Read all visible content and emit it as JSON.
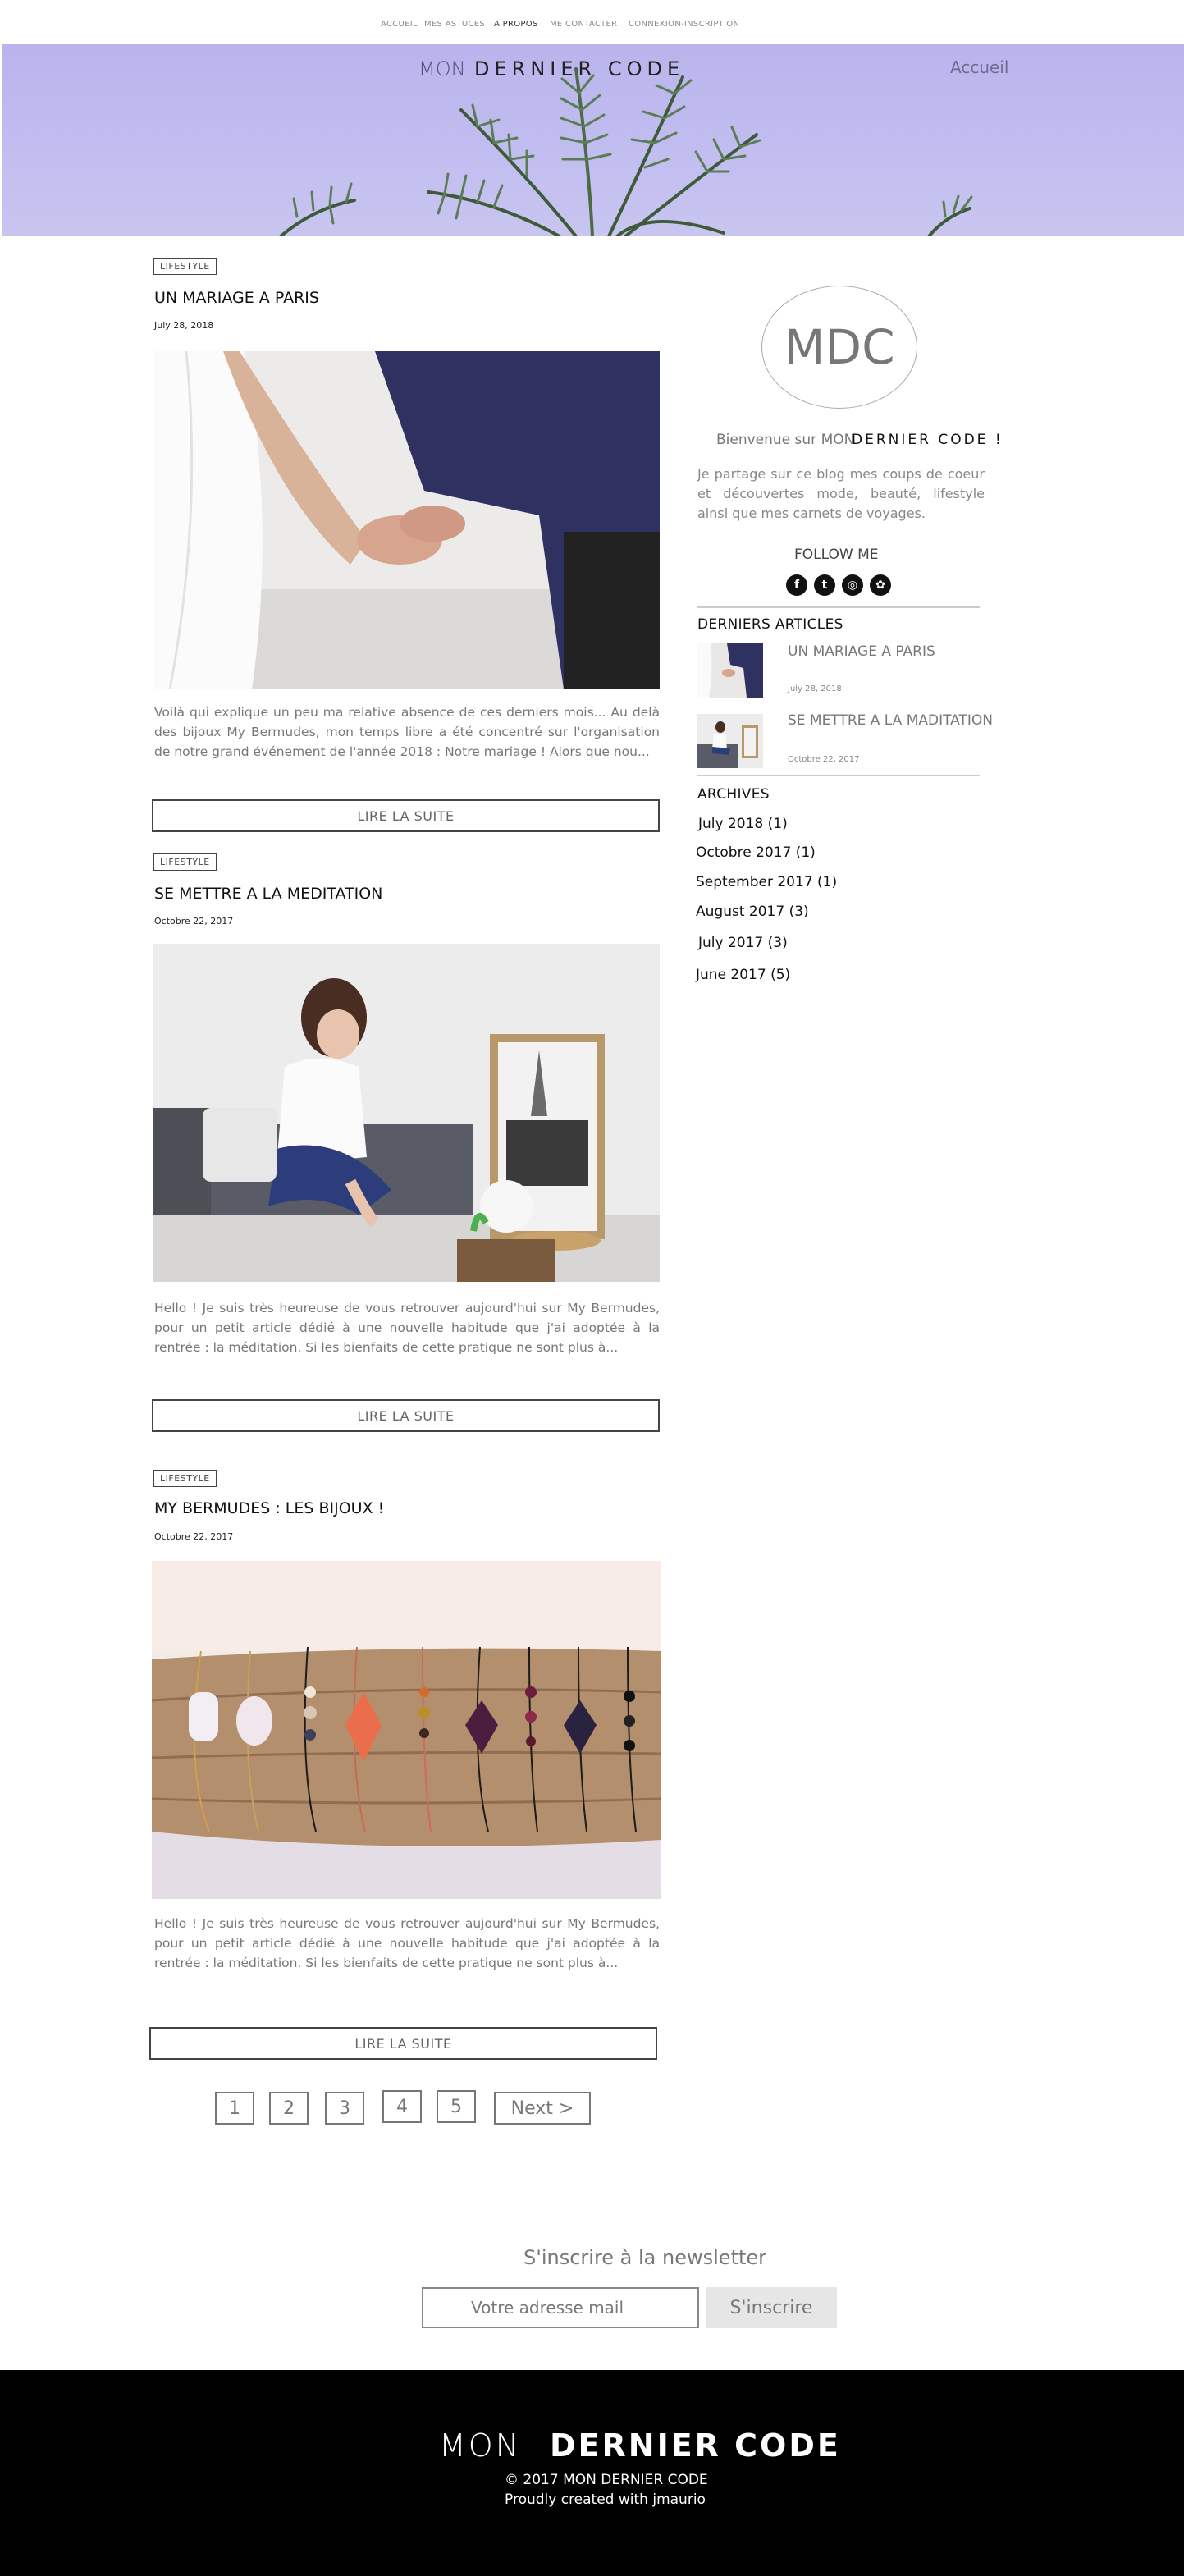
{
  "nav": {
    "items": [
      "ACCUEIL",
      "MES ASTUCES",
      "A PROPOS",
      "ME CONTACTER",
      "CONNEXION-INSCRIPTION"
    ],
    "active": "A PROPOS"
  },
  "hero": {
    "logo_mon": "MON",
    "logo_dernier_code": "DERNIER CODE",
    "link": "Accueil"
  },
  "posts": [
    {
      "tag": "LIFESTYLE",
      "title": "UN MARIAGE A PARIS",
      "date": "July 28, 2018",
      "excerpt": "Voilà qui explique un peu ma relative absence de ces derniers mois... Au delà des bijoux My Bermudes, mon temps libre a été concentré sur l'organisation de notre grand événement de l'année 2018 : Notre mariage ! Alors que nou...",
      "read_more": "LIRE LA SUITE"
    },
    {
      "tag": "LIFESTYLE",
      "title": "SE METTRE A LA MEDITATION",
      "date": "Octobre 22, 2017",
      "excerpt": "Hello ! Je suis très heureuse de vous retrouver aujourd'hui sur My Bermudes, pour un petit article dédié à une nouvelle habitude que j'ai adoptée à la rentrée : la méditation. Si les bienfaits de cette pratique ne sont plus à...",
      "read_more": "LIRE LA SUITE"
    },
    {
      "tag": "LIFESTYLE",
      "title": "MY BERMUDES : LES BIJOUX !",
      "date": "Octobre 22, 2017",
      "excerpt": "Hello ! Je suis très heureuse de vous retrouver aujourd'hui sur My Bermudes, pour un petit article dédié à une nouvelle habitude que j'ai adoptée à la rentrée : la méditation. Si les bienfaits de cette pratique ne sont plus à...",
      "read_more": "LIRE LA SUITE"
    }
  ],
  "sidebar": {
    "avatar_text": "MDC",
    "welcome_prefix": "Bienvenue sur MON",
    "welcome_brand": "DERNIER CODE !",
    "about": "Je partage sur ce blog mes coups de coeur et découvertes mode, beauté, lifestyle ainsi que mes carnets de voyages.",
    "follow_label": "FOLLOW ME",
    "social": [
      {
        "icon": "facebook-icon",
        "glyph": "f"
      },
      {
        "icon": "twitter-icon",
        "glyph": "t"
      },
      {
        "icon": "instagram-icon",
        "glyph": "◎"
      },
      {
        "icon": "yelp-icon",
        "glyph": "✿"
      }
    ],
    "recent_heading": "DERNIERS ARTICLES",
    "recent": [
      {
        "title": "UN MARIAGE A PARIS",
        "date": "July 28, 2018"
      },
      {
        "title": "SE METTRE A LA MADITATION",
        "date": "Octobre 22, 2017"
      }
    ],
    "archives_heading": "ARCHIVES",
    "archives": [
      "July 2018 (1)",
      "Octobre 2017 (1)",
      "September 2017 (1)",
      "August 2017 (3)",
      "July 2017 (3)",
      "June 2017 (5)"
    ]
  },
  "pagination": {
    "pages": [
      "1",
      "2",
      "3",
      "4",
      "5"
    ],
    "next": "Next >"
  },
  "newsletter": {
    "title": "S'inscrire à la newsletter",
    "placeholder": "Votre adresse mail",
    "button": "S'inscrire"
  },
  "footer": {
    "mon": "MON",
    "dernier_code": "DERNIER CODE",
    "copyright": "© 2017 MON DERNIER CODE",
    "credit": "Proudly created with jmaurio"
  },
  "colors": {
    "hero_bg": "#bcb7ee",
    "footer_bg": "#000000",
    "text_muted": "#777777"
  }
}
